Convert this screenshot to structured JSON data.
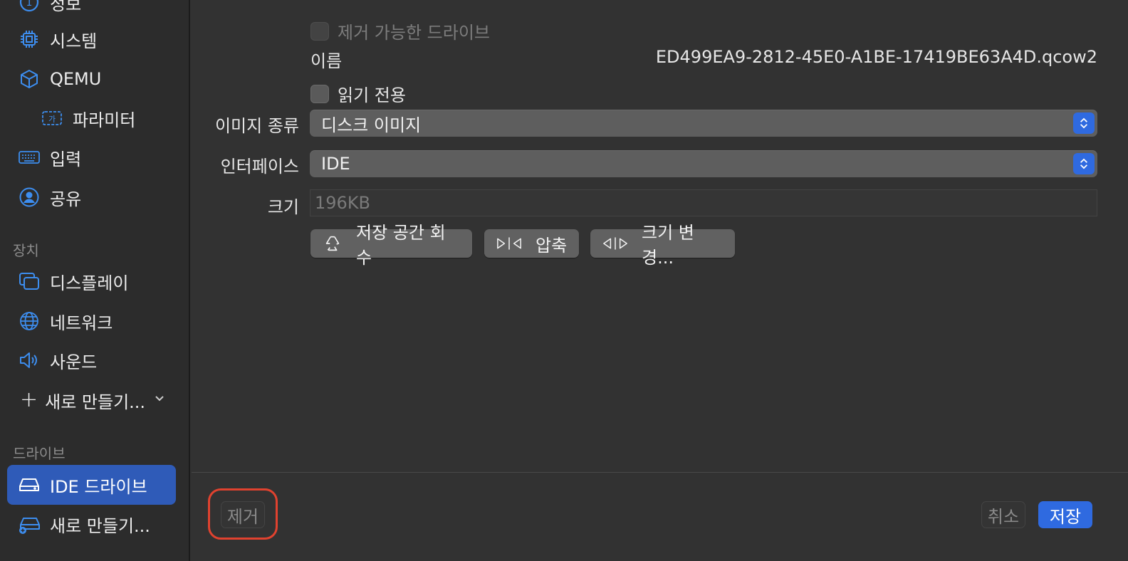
{
  "sidebar": {
    "items": [
      {
        "label": "정보",
        "icon": "info-icon"
      },
      {
        "label": "시스템",
        "icon": "cpu-icon"
      },
      {
        "label": "QEMU",
        "icon": "cube-icon"
      },
      {
        "label": "파라미터",
        "icon": "text-field-icon"
      },
      {
        "label": "입력",
        "icon": "keyboard-icon"
      },
      {
        "label": "공유",
        "icon": "person-circle-icon"
      }
    ],
    "devices_header": "장치",
    "devices": [
      {
        "label": "디스플레이",
        "icon": "display-icon"
      },
      {
        "label": "네트워크",
        "icon": "globe-icon"
      },
      {
        "label": "사운드",
        "icon": "speaker-icon"
      }
    ],
    "new_device_label": "새로 만들기...",
    "drives_header": "드라이브",
    "drives": [
      {
        "label": "IDE 드라이브",
        "icon": "drive-icon",
        "selected": true
      },
      {
        "label": "새로 만들기...",
        "icon": "drive-add-icon"
      }
    ]
  },
  "main": {
    "removable_label": "제거 가능한 드라이브",
    "name_label": "이름",
    "name_value": "ED499EA9-2812-45E0-A1BE-17419BE63A4D.qcow2",
    "readonly_label": "읽기 전용",
    "image_type_label": "이미지 종류",
    "image_type_value": "디스크 이미지",
    "interface_label": "인터페이스",
    "interface_value": "IDE",
    "size_label": "크기",
    "size_placeholder": "196KB",
    "reclaim_label": "저장 공간 회수",
    "compress_label": "압축",
    "resize_label": "크기 변경..."
  },
  "footer": {
    "remove_label": "제거",
    "cancel_label": "취소",
    "save_label": "저장"
  },
  "colors": {
    "accent": "#2f6ae0",
    "selected_bg": "#2f5bb8",
    "highlight": "#e0422f"
  }
}
